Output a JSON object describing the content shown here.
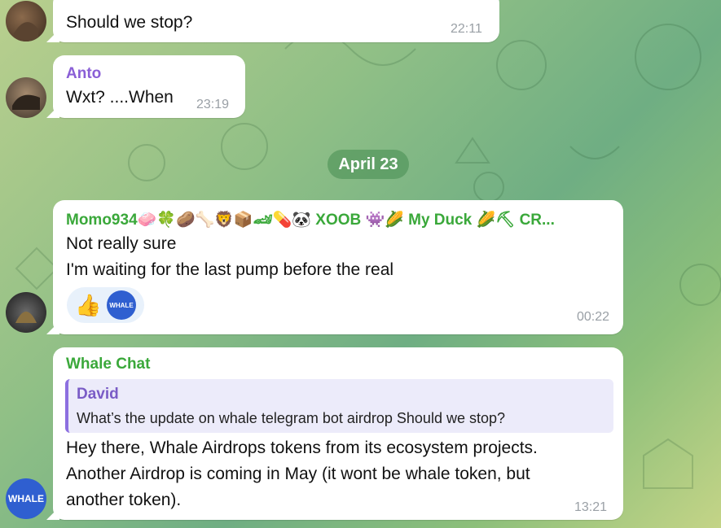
{
  "messages": [
    {
      "text": "Should we stop?",
      "time": "22:11"
    },
    {
      "sender": "Anto",
      "text": "Wxt? ....When",
      "time": "23:19"
    },
    {
      "date_separator": "April 23"
    },
    {
      "sender": "Momo934🧼🍀🥔🦴🦁📦🏎💊🐼 XOOB 👾🌽 My Duck 🌽⛏ CR...",
      "lines": [
        "Not really sure",
        "I'm waiting for the last pump before the real"
      ],
      "reactions": [
        "👍",
        "WHALE"
      ],
      "time": "00:22"
    },
    {
      "sender": "Whale Chat",
      "reply": {
        "author": "David",
        "text": "What’s the update on whale telegram bot airdrop Should we stop?"
      },
      "lines": [
        "Hey there, Whale Airdrops tokens from its ecosystem projects.",
        "Another Airdrop is coming in May (it wont be whale token, but",
        "another token)."
      ],
      "time": "13:21",
      "avatar_label": "WHALE"
    }
  ],
  "colors": {
    "anto": "#8a5fd6",
    "momo": "#3aa83a",
    "whale_chat": "#3aa83a",
    "david": "#7a5cc6",
    "whale_avatar": "#2f5fd0"
  }
}
